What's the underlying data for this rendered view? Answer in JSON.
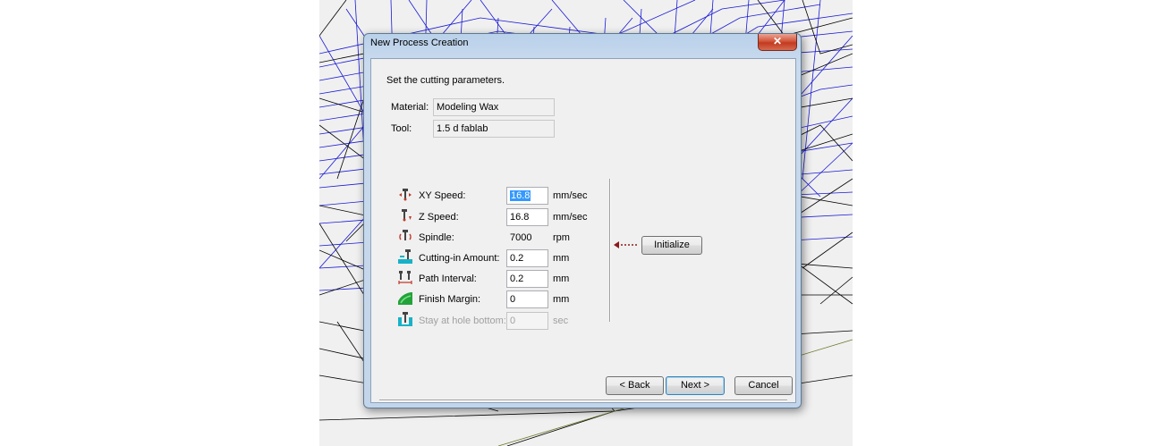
{
  "dialog": {
    "title": "New Process Creation",
    "close_label": "✕",
    "instruction": "Set the cutting parameters.",
    "material": {
      "label": "Material:",
      "value": "Modeling Wax"
    },
    "tool": {
      "label": "Tool:",
      "value": "1.5 d fablab"
    },
    "params": [
      {
        "icon": "xy-speed-icon",
        "label": "XY Speed:",
        "value": "16.8",
        "unit": "mm/sec",
        "selected": true,
        "enabled": true
      },
      {
        "icon": "z-speed-icon",
        "label": "Z Speed:",
        "value": "16.8",
        "unit": "mm/sec",
        "enabled": true
      },
      {
        "icon": "spindle-icon",
        "label": "Spindle:",
        "value": "7000",
        "unit": "rpm",
        "enabled": true,
        "readonly": true
      },
      {
        "icon": "cutting-in-amount-icon",
        "label": "Cutting-in Amount:",
        "value": "0.2",
        "unit": "mm",
        "enabled": true
      },
      {
        "icon": "path-interval-icon",
        "label": "Path Interval:",
        "value": "0.2",
        "unit": "mm",
        "enabled": true
      },
      {
        "icon": "finish-margin-icon",
        "label": "Finish Margin:",
        "value": "0",
        "unit": "mm",
        "enabled": true
      },
      {
        "icon": "stay-at-hole-bottom-icon",
        "label": "Stay at hole bottom:",
        "value": "0",
        "unit": "sec",
        "enabled": false
      }
    ],
    "initialize_label": "Initialize",
    "buttons": {
      "back": "< Back",
      "next": "Next >",
      "cancel": "Cancel"
    }
  },
  "colors": {
    "wire_blue": "#1a1ad6",
    "wire_black": "#000000",
    "selection": "#3399ff",
    "icon_red": "#c0392b",
    "icon_cyan": "#17b2c8",
    "icon_green": "#22a33a"
  }
}
